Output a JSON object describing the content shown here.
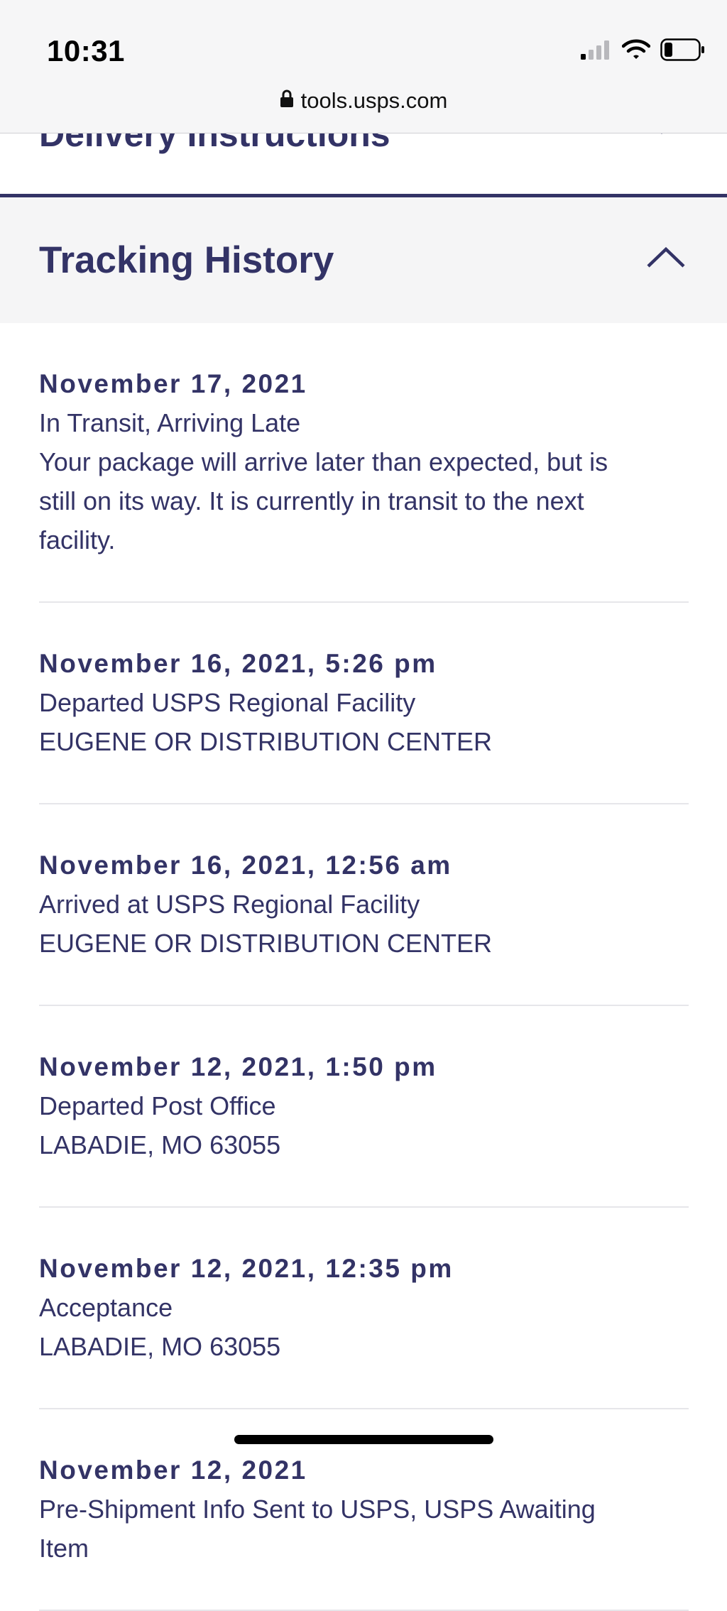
{
  "status_bar": {
    "time": "10:31",
    "url": "tools.usps.com"
  },
  "previous_section": {
    "title": "Delivery Instructions"
  },
  "tracking_history": {
    "title": "Tracking History",
    "events": [
      {
        "date": "November 17, 2021",
        "lines": [
          "In Transit, Arriving Late",
          "Your package will arrive later than expected, but is",
          "still on its way. It is currently in transit to the next",
          "facility."
        ]
      },
      {
        "date": "November 16, 2021, 5:26 pm",
        "lines": [
          "Departed USPS Regional Facility",
          "EUGENE OR DISTRIBUTION CENTER"
        ]
      },
      {
        "date": "November 16, 2021, 12:56 am",
        "lines": [
          "Arrived at USPS Regional Facility",
          "EUGENE OR DISTRIBUTION CENTER"
        ]
      },
      {
        "date": "November 12, 2021, 1:50 pm",
        "lines": [
          "Departed Post Office",
          "LABADIE, MO 63055"
        ]
      },
      {
        "date": "November 12, 2021, 12:35 pm",
        "lines": [
          "Acceptance",
          "LABADIE, MO 63055"
        ]
      },
      {
        "date": "November 12, 2021",
        "lines": [
          "Pre-Shipment Info Sent to USPS, USPS Awaiting",
          "Item"
        ]
      }
    ]
  },
  "colors": {
    "brand_navy": "#333366",
    "header_bg": "#f5f5f6",
    "divider": "#e6e6ea"
  },
  "icons": {
    "lock": "lock-icon",
    "signal": "cellular-signal-icon",
    "wifi": "wifi-icon",
    "battery": "battery-icon",
    "expand": "chevron-down-icon",
    "collapse": "chevron-up-icon"
  }
}
